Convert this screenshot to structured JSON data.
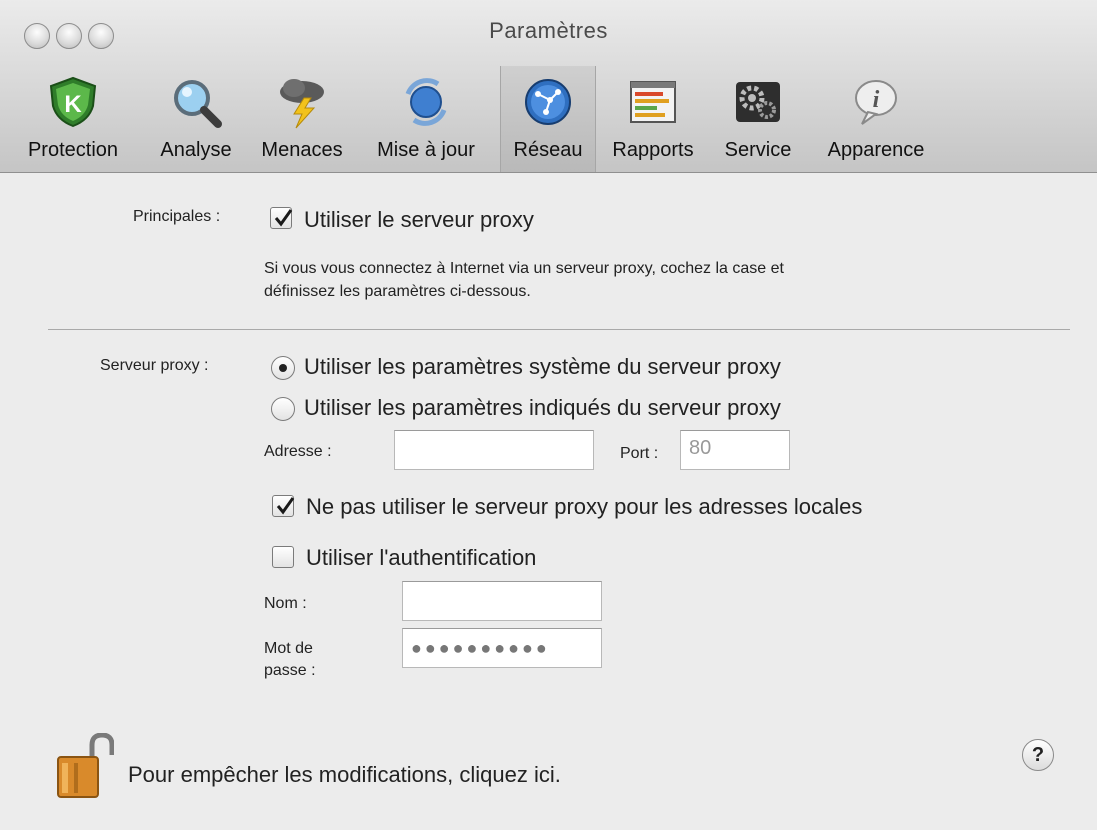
{
  "window": {
    "title": "Paramètres"
  },
  "toolbar": {
    "items": [
      {
        "label": "Protection",
        "icon": "shield-k-icon"
      },
      {
        "label": "Analyse",
        "icon": "magnifier-icon"
      },
      {
        "label": "Menaces",
        "icon": "storm-cloud-icon"
      },
      {
        "label": "Mise à jour",
        "icon": "update-globe-icon"
      },
      {
        "label": "Réseau",
        "icon": "network-globe-icon",
        "selected": true
      },
      {
        "label": "Rapports",
        "icon": "report-icon"
      },
      {
        "label": "Service",
        "icon": "gears-icon"
      },
      {
        "label": "Apparence",
        "icon": "info-bubble-icon"
      }
    ]
  },
  "general": {
    "label": "Principales :",
    "use_proxy": {
      "label": "Utiliser le serveur proxy",
      "checked": true
    },
    "description_line1": "Si vous vous connectez à Internet via un serveur proxy, cochez la case et",
    "description_line2": "définissez les paramètres ci-dessous."
  },
  "proxy": {
    "label": "Serveur proxy :",
    "option_system": {
      "label": "Utiliser les paramètres système du serveur proxy",
      "selected": true
    },
    "option_manual": {
      "label": "Utiliser les paramètres indiqués du serveur proxy",
      "selected": false
    },
    "address_label": "Adresse :",
    "address_value": "",
    "port_label": "Port :",
    "port_value": "80",
    "bypass_local": {
      "label": "Ne pas utiliser le serveur proxy pour les adresses locales",
      "checked": true
    },
    "use_auth": {
      "label": "Utiliser l'authentification",
      "checked": false
    },
    "name_label": "Nom :",
    "name_value": "",
    "password_label_line1": "Mot de",
    "password_label_line2": "passe :",
    "password_value": "●●●●●●●●●●"
  },
  "footer": {
    "lock_text": "Pour empêcher les modifications, cliquez ici.",
    "help_label": "?"
  },
  "colors": {
    "check": "#1a1a1a",
    "lock_body": "#d98a2b"
  }
}
